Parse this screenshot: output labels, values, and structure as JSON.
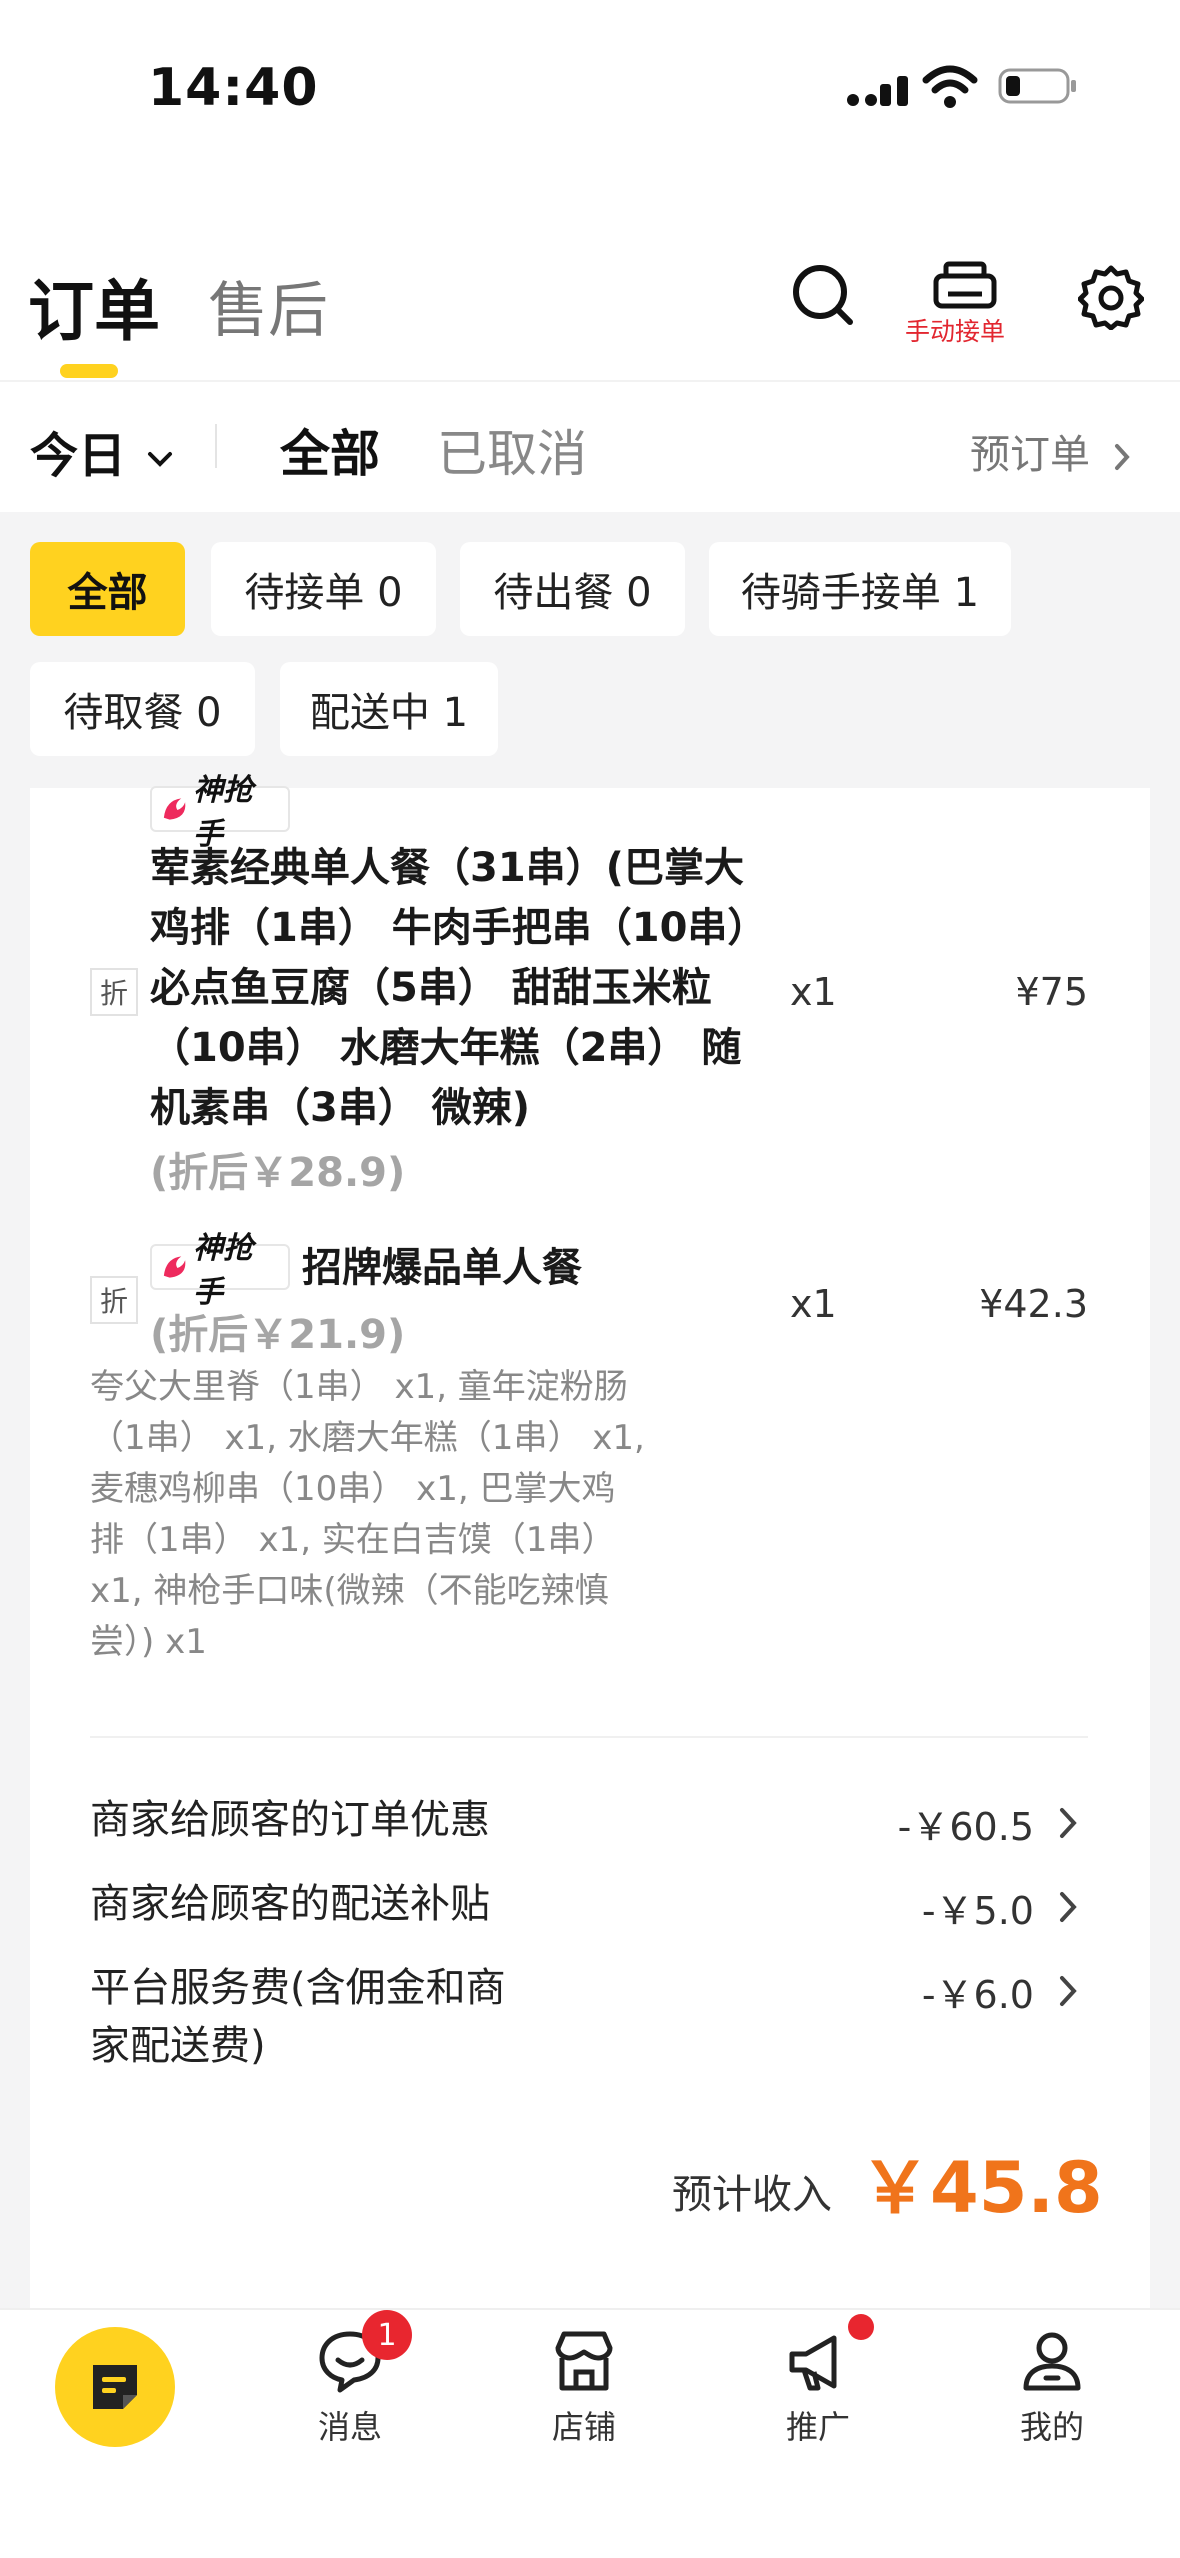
{
  "status_bar": {
    "time": "14:40"
  },
  "header": {
    "tab_active": "订单",
    "tab_inactive": "售后",
    "manual_accept_label": "手动接单"
  },
  "filter": {
    "date": "今日",
    "all": "全部",
    "cancelled": "已取消",
    "preorder": "预订单"
  },
  "chips": [
    {
      "label": "全部"
    },
    {
      "label": "待接单 0"
    },
    {
      "label": "待出餐 0"
    },
    {
      "label": "待骑手接单 1"
    },
    {
      "label": "待取餐 0"
    },
    {
      "label": "配送中 1"
    }
  ],
  "order": {
    "brand": "神抢手",
    "discount_tag": "折",
    "items": [
      {
        "name_lines": [
          "荤素经典单人餐（31串）(巴掌大",
          "鸡排（1串） 牛肉手把串（10串）",
          "必点鱼豆腐（5串） 甜甜玉米粒",
          "（10串） 水磨大年糕（2串） 随",
          "机素串（3串） 微辣)"
        ],
        "discounted": "(折后￥28.9)",
        "qty": "x1",
        "price": "¥75"
      },
      {
        "name": "招牌爆品单人餐",
        "discounted": "(折后￥21.9)",
        "qty": "x1",
        "price": "¥42.3",
        "sub_lines": [
          "夸父大里脊（1串） x1, 童年淀粉肠",
          "（1串） x1, 水磨大年糕（1串） x1,",
          "麦穗鸡柳串（10串） x1, 巴掌大鸡",
          "排（1串） x1, 实在白吉馍（1串）",
          "x1, 神枪手口味(微辣（不能吃辣慎",
          "尝）) x1"
        ]
      }
    ],
    "fees": [
      {
        "label_lines": [
          "商家给顾客的订单优惠"
        ],
        "value": "-￥60.5"
      },
      {
        "label_lines": [
          "商家给顾客的配送补贴"
        ],
        "value": "-￥5.0"
      },
      {
        "label_lines": [
          "平台服务费(含佣金和商",
          "家配送费)"
        ],
        "value": "-￥6.0"
      }
    ],
    "estimated_label": "预计收入",
    "estimated_value": "￥45.8"
  },
  "nav": {
    "items": [
      {
        "label": "消息",
        "icon": "message-icon"
      },
      {
        "label": "店铺",
        "icon": "store-icon"
      },
      {
        "label": "推广",
        "icon": "megaphone-icon"
      },
      {
        "label": "我的",
        "icon": "profile-icon"
      }
    ],
    "message_badge": "1"
  },
  "colors": {
    "accent": "#ffd21f",
    "income": "#f0741b",
    "alert": "#e8262f"
  }
}
